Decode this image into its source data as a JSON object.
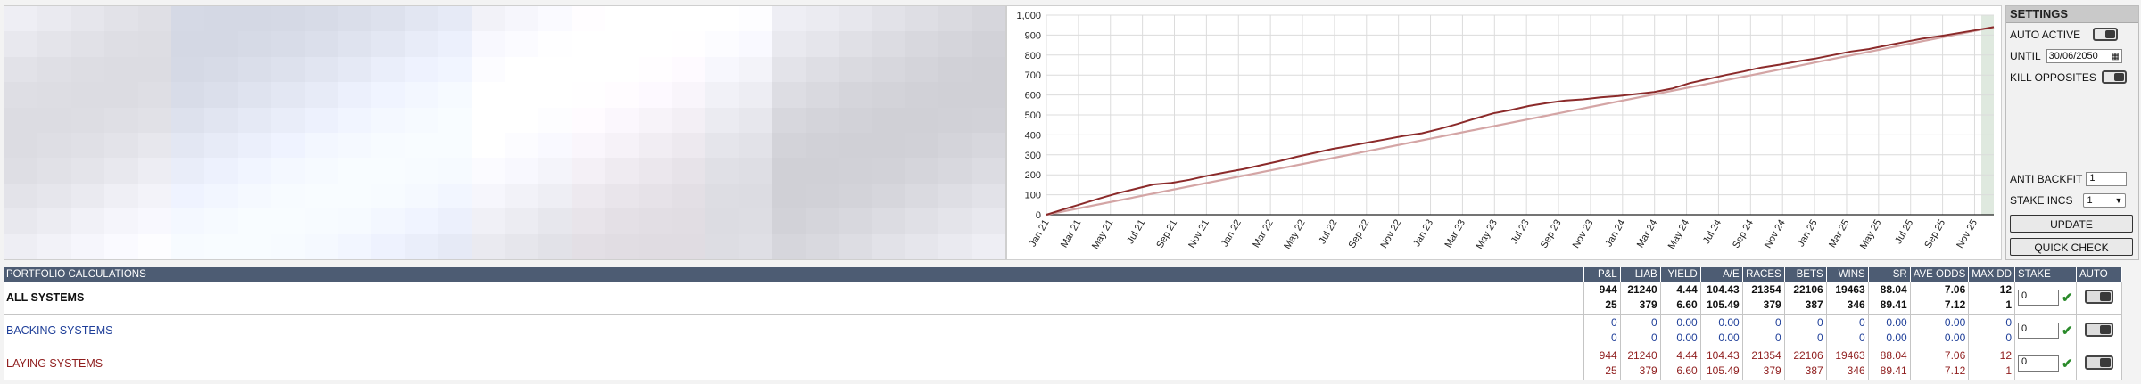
{
  "settings": {
    "title": "SETTINGS",
    "auto_active_label": "AUTO ACTIVE",
    "until_label": "UNTIL",
    "until_value": "30/06/2050",
    "kill_opposites_label": "KILL OPPOSITES",
    "anti_backfit_label": "ANTI BACKFIT",
    "anti_backfit_value": "1",
    "stake_incs_label": "STAKE INCS",
    "stake_incs_value": "1",
    "update_label": "UPDATE",
    "quick_check_label": "QUICK CHECK"
  },
  "chart_data": {
    "type": "line",
    "ylim": [
      0,
      1000
    ],
    "yticks": [
      "0",
      "100",
      "200",
      "300",
      "400",
      "500",
      "600",
      "700",
      "800",
      "900",
      "1,000"
    ],
    "xticks": [
      "Jan 21",
      "Mar 21",
      "May 21",
      "Jul 21",
      "Sep 21",
      "Nov 21",
      "Jan 22",
      "Mar 22",
      "May 22",
      "Jul 22",
      "Sep 22",
      "Nov 22",
      "Jan 23",
      "Mar 23",
      "May 23",
      "Jul 23",
      "Sep 23",
      "Nov 23",
      "Jan 24",
      "Mar 24",
      "May 24",
      "Jul 24",
      "Sep 24",
      "Nov 24",
      "Jan 25",
      "Mar 25",
      "May 25",
      "Jul 25",
      "Sep 25",
      "Nov 25"
    ],
    "grid": true,
    "series": [
      {
        "color": "#8b2a2a",
        "points": [
          [
            0,
            0
          ],
          [
            1,
            28
          ],
          [
            2,
            55
          ],
          [
            3,
            82
          ],
          [
            4,
            108
          ],
          [
            5,
            130
          ],
          [
            6,
            152
          ],
          [
            7,
            160
          ],
          [
            8,
            175
          ],
          [
            9,
            195
          ],
          [
            10,
            212
          ],
          [
            11,
            228
          ],
          [
            12,
            248
          ],
          [
            13,
            268
          ],
          [
            14,
            290
          ],
          [
            15,
            310
          ],
          [
            16,
            330
          ],
          [
            17,
            345
          ],
          [
            18,
            362
          ],
          [
            19,
            378
          ],
          [
            20,
            395
          ],
          [
            21,
            408
          ],
          [
            22,
            430
          ],
          [
            23,
            455
          ],
          [
            24,
            482
          ],
          [
            25,
            508
          ],
          [
            26,
            525
          ],
          [
            27,
            545
          ],
          [
            28,
            560
          ],
          [
            29,
            572
          ],
          [
            30,
            578
          ],
          [
            31,
            588
          ],
          [
            32,
            595
          ],
          [
            33,
            605
          ],
          [
            34,
            615
          ],
          [
            35,
            632
          ],
          [
            36,
            660
          ],
          [
            37,
            680
          ],
          [
            38,
            700
          ],
          [
            39,
            718
          ],
          [
            40,
            738
          ],
          [
            41,
            752
          ],
          [
            42,
            768
          ],
          [
            43,
            782
          ],
          [
            44,
            800
          ],
          [
            45,
            818
          ],
          [
            46,
            830
          ],
          [
            47,
            848
          ],
          [
            48,
            865
          ],
          [
            49,
            882
          ],
          [
            50,
            895
          ],
          [
            51,
            910
          ],
          [
            52,
            925
          ],
          [
            53,
            940
          ]
        ]
      },
      {
        "color": "#d4a5a5",
        "points": [
          [
            0,
            0
          ],
          [
            53,
            940
          ]
        ]
      }
    ]
  },
  "portfolio": {
    "title": "PORTFOLIO CALCULATIONS",
    "columns": [
      "P&L",
      "LIAB",
      "YIELD",
      "A/E",
      "RACES",
      "BETS",
      "WINS",
      "SR",
      "AVE ODDS",
      "MAX DD",
      "STAKE",
      "AUTO"
    ],
    "rows": [
      {
        "name": "ALL SYSTEMS",
        "line1": [
          "944",
          "21240",
          "4.44",
          "104.43",
          "21354",
          "22106",
          "19463",
          "88.04",
          "7.06",
          "12"
        ],
        "line2": [
          "25",
          "379",
          "6.60",
          "105.49",
          "379",
          "387",
          "346",
          "89.41",
          "7.12",
          "1"
        ],
        "stake": "0"
      },
      {
        "name": "BACKING SYSTEMS",
        "line1": [
          "0",
          "0",
          "0.00",
          "0.00",
          "0",
          "0",
          "0",
          "0.00",
          "0.00",
          "0"
        ],
        "line2": [
          "0",
          "0",
          "0.00",
          "0.00",
          "0",
          "0",
          "0",
          "0.00",
          "0.00",
          "0"
        ],
        "stake": "0"
      },
      {
        "name": "LAYING SYSTEMS",
        "line1": [
          "944",
          "21240",
          "4.44",
          "104.43",
          "21354",
          "22106",
          "19463",
          "88.04",
          "7.06",
          "12"
        ],
        "line2": [
          "25",
          "379",
          "6.60",
          "105.49",
          "379",
          "387",
          "346",
          "89.41",
          "7.12",
          "1"
        ],
        "stake": "0"
      }
    ]
  }
}
